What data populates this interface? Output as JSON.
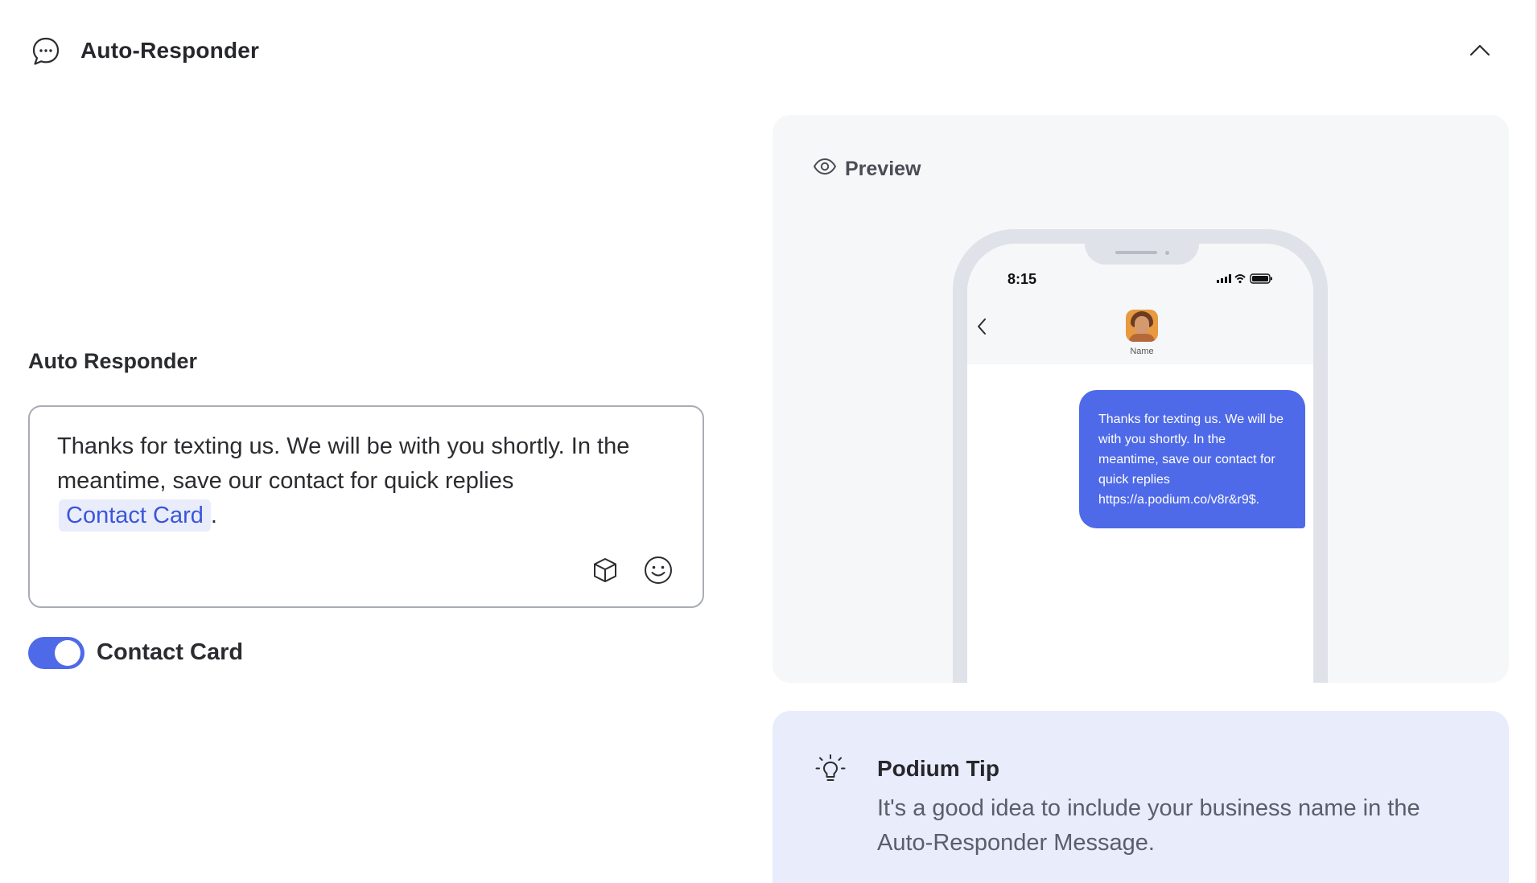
{
  "header": {
    "title": "Auto-Responder",
    "icon": "chat-bubble-icon",
    "collapse_icon": "chevron-up-icon"
  },
  "editor": {
    "label": "Auto Responder",
    "message_text": "Thanks for texting us. We will be with you shortly. In the meantime, save our contact for quick replies",
    "chip_label": "Contact Card",
    "trailing_punct": ".",
    "tool_icons": [
      "box-icon",
      "emoji-icon"
    ]
  },
  "toggle": {
    "label": "Contact Card",
    "enabled": true,
    "color": "#4f6ae8"
  },
  "preview": {
    "title": "Preview",
    "icon": "eye-icon",
    "phone": {
      "time": "8:15",
      "contact_name": "Name",
      "bubble_text": "Thanks for texting us. We will be with you shortly. In the meantime, save our contact for quick replies https://a.podium.co/v8r&r9$.",
      "bubble_color": "#4f6ae8"
    }
  },
  "tip": {
    "title": "Podium Tip",
    "icon": "lightbulb-icon",
    "body": "It's a good idea to include your business name in the Auto-Responder Message."
  }
}
